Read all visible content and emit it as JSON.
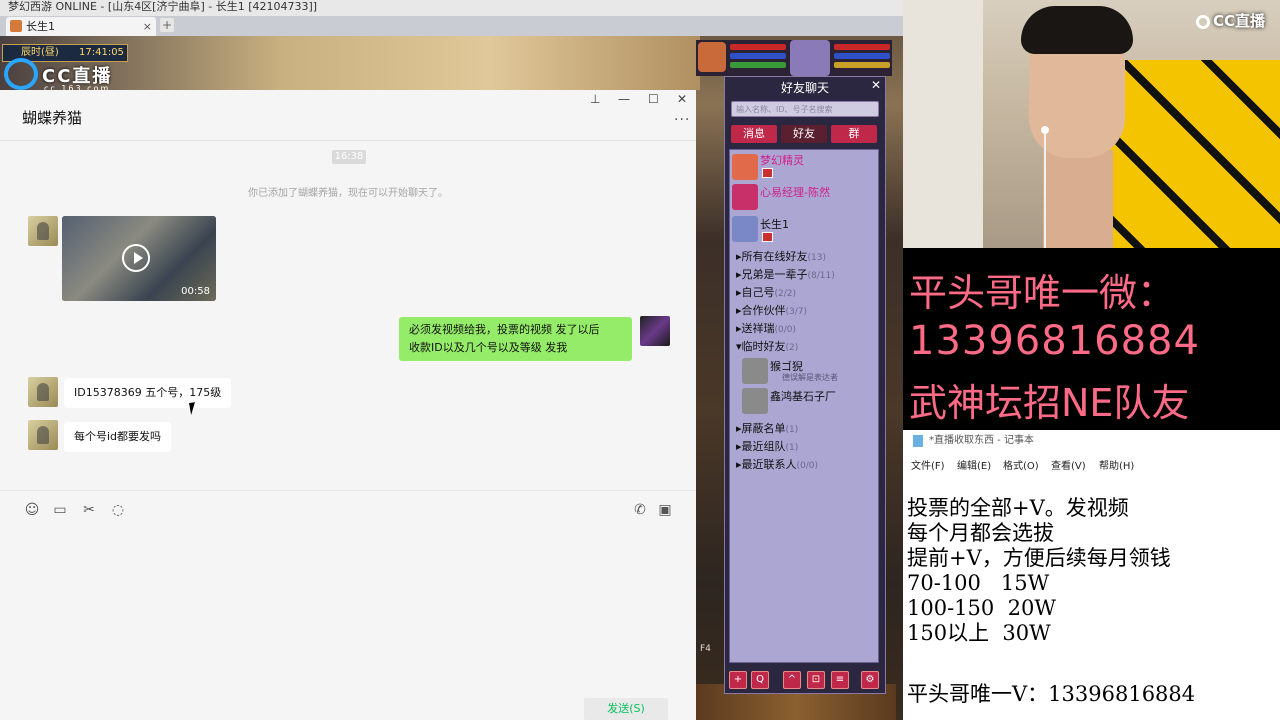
{
  "game": {
    "titlebar_text": "梦幻西游 ONLINE - [山东4区[济宁曲阜] - 长生1 [42104733]]",
    "tab_label": "长生1",
    "tab_close": "×",
    "tab_add": "+",
    "clock_period": "辰时(昼)",
    "clock_time": "17:41:05",
    "cc_watermark": "CC直播",
    "cc_watermark_sub": "cc.163.com",
    "hotkey_label": "F4"
  },
  "chat": {
    "contact_name": "蝴蝶养猫",
    "window_controls": {
      "pin": "⊥",
      "minimize": "—",
      "maximize": "☐",
      "close": "✕"
    },
    "more": "···",
    "time_divider": "16:38",
    "system_message": "你已添加了蝴蝶养猫，现在可以开始聊天了。",
    "video_duration": "00:58",
    "my_message_line1": "必须发视频给我，投票的视频 发了以后",
    "my_message_line2": "收款ID以及几个号以及等级 发我",
    "reply1": "ID15378369 五个号，175级",
    "reply2": "每个号id都要发吗",
    "toolbar_icons": [
      "emoji-icon",
      "folder-icon",
      "scissors-icon",
      "chat-history-icon",
      "phone-icon",
      "video-call-icon"
    ],
    "send_label": "发送(S)"
  },
  "friend_panel": {
    "title": "好友聊天",
    "close": "✕",
    "search_placeholder": "输入名称、ID、号子名搜索",
    "tabs": [
      "消息",
      "好友",
      "群"
    ],
    "top_friends": [
      "梦幻精灵",
      "心易经理-陈然",
      "长生1"
    ],
    "groups": [
      {
        "label": "所有在线好友",
        "count": "(13)"
      },
      {
        "label": "兄弟是一辈子",
        "count": "(8/11)"
      },
      {
        "label": "自己号",
        "count": "(2/2)"
      },
      {
        "label": "合作伙伴",
        "count": "(3/7)"
      },
      {
        "label": "送祥瑞",
        "count": "(0/0)"
      },
      {
        "label": "临时好友",
        "count": "(2)"
      }
    ],
    "temp_friends": [
      {
        "name": "猴ゴ猊",
        "sub": "德误解是表达者"
      },
      {
        "name": "鑫鸿基石子厂",
        "sub": ""
      }
    ],
    "bottom_groups": [
      {
        "label": "屏蔽名单",
        "count": "(1)"
      },
      {
        "label": "最近组队",
        "count": "(1)"
      },
      {
        "label": "最近联系人",
        "count": "(0/0)"
      }
    ],
    "expand_arrow": "▸",
    "collapse_arrow": "▾",
    "bottom_buttons": [
      "+",
      "Q",
      "^",
      "⊡",
      "≡",
      "⚙"
    ]
  },
  "stream": {
    "brand": "CC直播",
    "promo_line1": "平头哥唯一微：",
    "promo_line2": "13396816884",
    "promo_line3": "武神坛招NE队友"
  },
  "notepad": {
    "title": "*直播收取东西 - 记事本",
    "menu": [
      "文件(F)",
      "编辑(E)",
      "格式(O)",
      "查看(V)",
      "帮助(H)"
    ],
    "lines": [
      "投票的全部+V。发视频",
      "每个月都会选拔",
      "提前+V，方便后续每月领钱",
      "70-100   15W",
      "100-150  20W",
      "150以上  30W"
    ],
    "last_line": "平头哥唯一V：13396816884"
  },
  "colors": {
    "wechat_green_bubble": "#95ec69",
    "send_text_green": "#07c160",
    "promo_pink": "#ff6b86",
    "panel_bg": "#aca6d2",
    "tab_red": "#c0284a"
  }
}
